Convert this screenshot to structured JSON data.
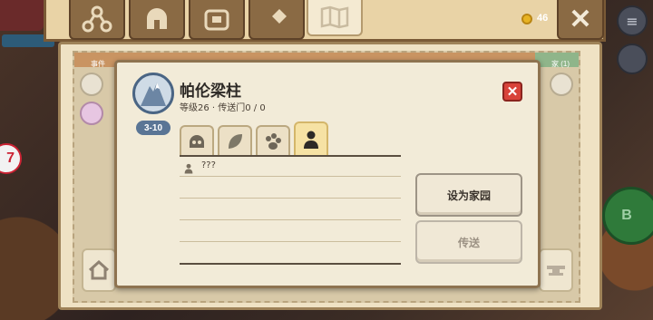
{
  "currency": {
    "count": "46",
    "icon": "coin-icon"
  },
  "tabs": [
    {
      "icon": "skill-tree-icon"
    },
    {
      "icon": "helmet-icon"
    },
    {
      "icon": "backpack-icon"
    },
    {
      "icon": "crafting-icon"
    },
    {
      "icon": "map-icon",
      "active": true
    }
  ],
  "underlying_panel": {
    "left_header": "事件",
    "right_header": "家 (1)"
  },
  "dialog": {
    "title": "帕伦梁柱",
    "subtitle": "等级26 · 传送门0 / 0",
    "level_range": "3-10",
    "category_tabs": [
      "monster-icon",
      "leaf-icon",
      "paw-icon",
      "person-icon"
    ],
    "rows": [
      {
        "icon": "person-icon",
        "text": "???"
      }
    ],
    "buttons": {
      "set_home": "设为家园",
      "teleport": "传送"
    }
  },
  "hud": {
    "b_button": "B",
    "left_badge": "7"
  },
  "colors": {
    "accent_red": "#d8433a",
    "emblem_blue": "#4a6584",
    "coin_gold": "#e7b324"
  }
}
